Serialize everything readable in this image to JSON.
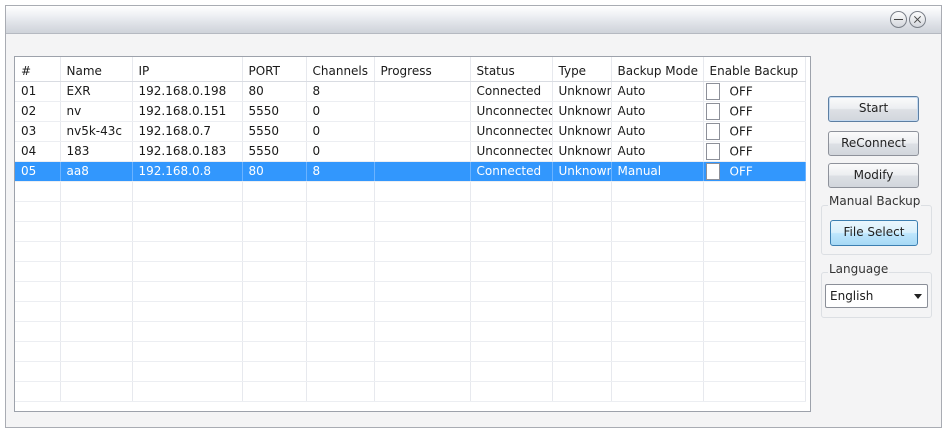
{
  "table": {
    "columns": [
      "#",
      "Name",
      "IP",
      "PORT",
      "Channels",
      "Progress",
      "Status",
      "Type",
      "Backup Mode",
      "Enable Backup"
    ],
    "rows": [
      {
        "num": "01",
        "name": "EXR",
        "ip": "192.168.0.198",
        "port": "80",
        "channels": "8",
        "progress": "",
        "status": "Connected",
        "type": "Unknown",
        "mode": "Auto",
        "enable": "OFF"
      },
      {
        "num": "02",
        "name": "nv",
        "ip": "192.168.0.151",
        "port": "5550",
        "channels": "0",
        "progress": "",
        "status": "Unconnected",
        "type": "Unknown",
        "mode": "Auto",
        "enable": "OFF"
      },
      {
        "num": "03",
        "name": "nv5k-43c",
        "ip": "192.168.0.7",
        "port": "5550",
        "channels": "0",
        "progress": "",
        "status": "Unconnected",
        "type": "Unknown",
        "mode": "Auto",
        "enable": "OFF"
      },
      {
        "num": "04",
        "name": "183",
        "ip": "192.168.0.183",
        "port": "5550",
        "channels": "0",
        "progress": "",
        "status": "Unconnected",
        "type": "Unknown",
        "mode": "Auto",
        "enable": "OFF"
      },
      {
        "num": "05",
        "name": "aa8",
        "ip": "192.168.0.8",
        "port": "80",
        "channels": "8",
        "progress": "",
        "status": "Connected",
        "type": "Unknown",
        "mode": "Manual",
        "enable": "OFF"
      }
    ],
    "selected_row": 4
  },
  "buttons": {
    "start": "Start",
    "reconnect": "ReConnect",
    "modify": "Modify",
    "file_select": "File Select"
  },
  "groups": {
    "manual_backup": "Manual Backup",
    "language": "Language"
  },
  "language": {
    "selected": "English"
  },
  "colors": {
    "selection": "#3297fd"
  }
}
